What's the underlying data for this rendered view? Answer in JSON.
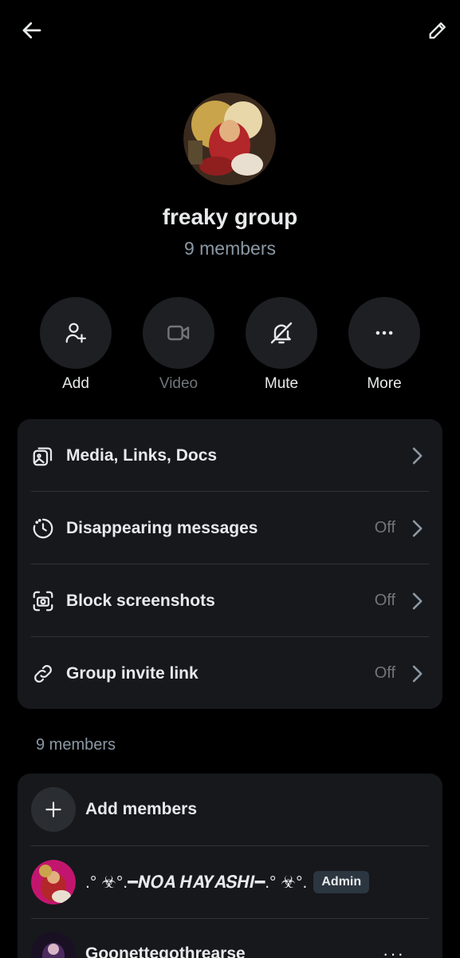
{
  "topbar": {
    "back_icon": "arrow-left-icon",
    "edit_icon": "pencil-icon"
  },
  "header": {
    "group_name": "freaky group",
    "member_count": "9 members"
  },
  "actions": [
    {
      "label": "Add",
      "icon": "add-person-icon",
      "enabled": true
    },
    {
      "label": "Video",
      "icon": "video-camera-icon",
      "enabled": false
    },
    {
      "label": "Mute",
      "icon": "bell-off-icon",
      "enabled": true
    },
    {
      "label": "More",
      "icon": "more-horizontal-icon",
      "enabled": true
    }
  ],
  "settings": [
    {
      "label": "Media, Links, Docs",
      "value": "",
      "icon": "media-gallery-icon"
    },
    {
      "label": "Disappearing messages",
      "value": "Off",
      "icon": "timer-icon"
    },
    {
      "label": "Block screenshots",
      "value": "Off",
      "icon": "camera-block-icon"
    },
    {
      "label": "Group invite link",
      "value": "Off",
      "icon": "link-icon"
    }
  ],
  "members_section": {
    "title": "9 members",
    "add_label": "Add members",
    "members": [
      {
        "name": ".° ☣°.━𝑵𝑶𝑨 𝑯𝑨𝒀𝑨𝑺𝑯𝑰━.° ☣°.",
        "badge": "Admin"
      },
      {
        "name": "Goonettegothrearse",
        "badge": ""
      }
    ]
  },
  "colors": {
    "background": "#000000",
    "card": "#16181c",
    "text": "#e7e9ea",
    "muted": "#71767b",
    "badge_bg": "#2c3640"
  }
}
